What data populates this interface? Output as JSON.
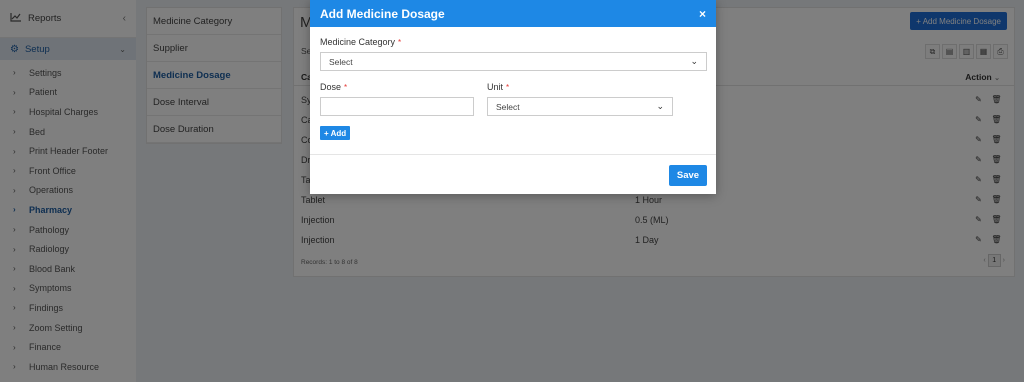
{
  "sidebar": {
    "reports_label": "Reports",
    "setup_label": "Setup",
    "items": [
      {
        "label": "Settings"
      },
      {
        "label": "Patient"
      },
      {
        "label": "Hospital Charges"
      },
      {
        "label": "Bed"
      },
      {
        "label": "Print Header Footer"
      },
      {
        "label": "Front Office"
      },
      {
        "label": "Operations"
      },
      {
        "label": "Pharmacy"
      },
      {
        "label": "Pathology"
      },
      {
        "label": "Radiology"
      },
      {
        "label": "Blood Bank"
      },
      {
        "label": "Symptoms"
      },
      {
        "label": "Findings"
      },
      {
        "label": "Zoom Setting"
      },
      {
        "label": "Finance"
      },
      {
        "label": "Human Resource"
      }
    ]
  },
  "subnav": {
    "items": [
      {
        "label": "Medicine Category"
      },
      {
        "label": "Supplier"
      },
      {
        "label": "Medicine Dosage"
      },
      {
        "label": "Dose Interval"
      },
      {
        "label": "Dose Duration"
      }
    ]
  },
  "panel": {
    "title_partial": "Me",
    "add_button": "+ Add Medicine Dosage",
    "search_partial": "Se",
    "col_first_partial": "Ca",
    "col_action": "Action",
    "rows": [
      {
        "c1": "Sy",
        "c2": ""
      },
      {
        "c1": "Ca",
        "c2": ""
      },
      {
        "c1": "Co",
        "c2": ""
      },
      {
        "c1": "Dr",
        "c2": ""
      },
      {
        "c1": "Ta",
        "c2": ""
      },
      {
        "c1": "Tablet",
        "c2": "1 Hour"
      },
      {
        "c1": "Injection",
        "c2": "0.5 (ML)"
      },
      {
        "c1": "Injection",
        "c2": "1 Day"
      }
    ],
    "records_text": "Records: 1 to 8 of 8",
    "pager": {
      "prev": "‹",
      "page": "1",
      "next": "›"
    }
  },
  "modal": {
    "title": "Add Medicine Dosage",
    "close": "×",
    "category_label": "Medicine Category",
    "category_value": "Select",
    "dose_label": "Dose",
    "dose_value": "",
    "unit_label": "Unit",
    "unit_value": "Select",
    "required_mark": "*",
    "add_label": "+ Add",
    "save_label": "Save"
  }
}
